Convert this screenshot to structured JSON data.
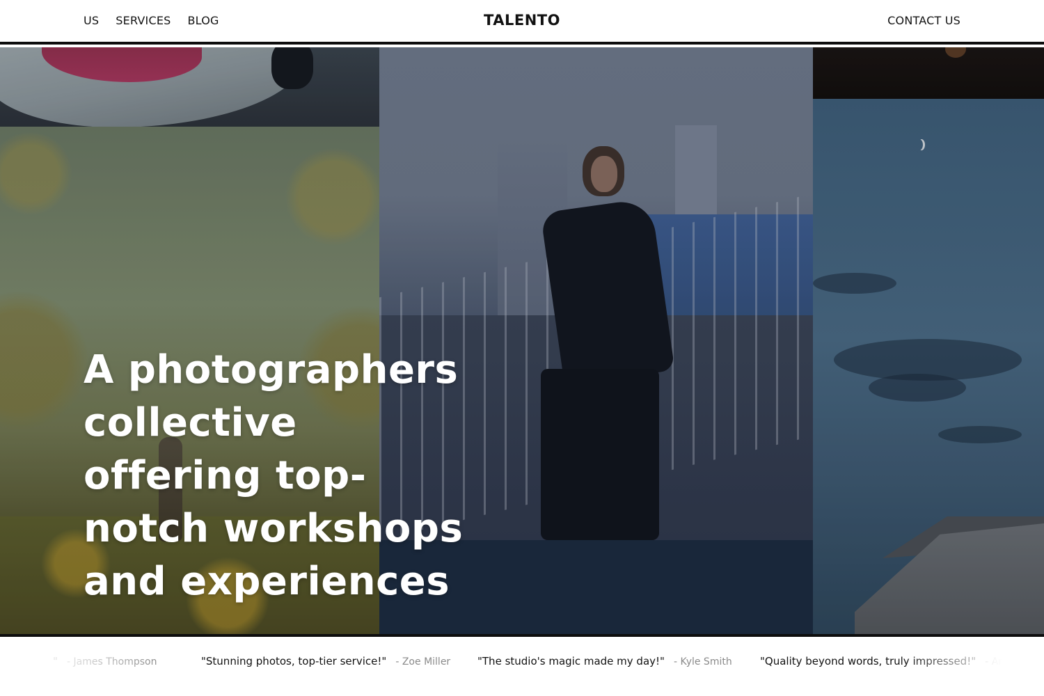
{
  "header": {
    "nav_left": [
      "US",
      "SERVICES",
      "BLOG"
    ],
    "logo": "TALENTO",
    "nav_right": "CONTACT US"
  },
  "hero": {
    "headline": "A photographers collective offering top-notch workshops and experiences"
  },
  "testimonials": [
    {
      "quote": "\"",
      "author": "- James Thompson"
    },
    {
      "quote": "\"Stunning photos, top-tier service!\"",
      "author": "- Zoe Miller"
    },
    {
      "quote": "\"The studio's magic made my day!\"",
      "author": "- Kyle Smith"
    },
    {
      "quote": "\"Quality beyond words, truly impressed!\"",
      "author": "- Amb"
    }
  ],
  "colors": {
    "border": "#0d0d0d",
    "headline": "#ffffff",
    "author": "#8a8a8a"
  }
}
